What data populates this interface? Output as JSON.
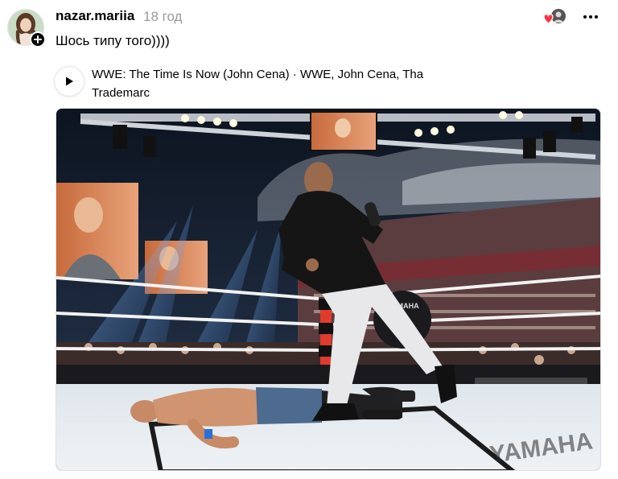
{
  "post": {
    "username": "nazar.mariia",
    "timestamp": "18 год",
    "text": "Шось типу того))))",
    "music": {
      "title": "WWE: The Time Is Now (John Cena) · WWE, John Cena, Tha Trademarc"
    },
    "photo": {
      "banner_brand": "YAMAHA",
      "ring_apron_text": "YAMAHA"
    }
  },
  "colors": {
    "username": "#000000",
    "timestamp": "#999999",
    "heart": "#ff3040"
  },
  "icons": {
    "follow": "plus-icon",
    "more": "more-horizontal-icon",
    "play": "play-icon",
    "reaction": "heart-icon"
  }
}
